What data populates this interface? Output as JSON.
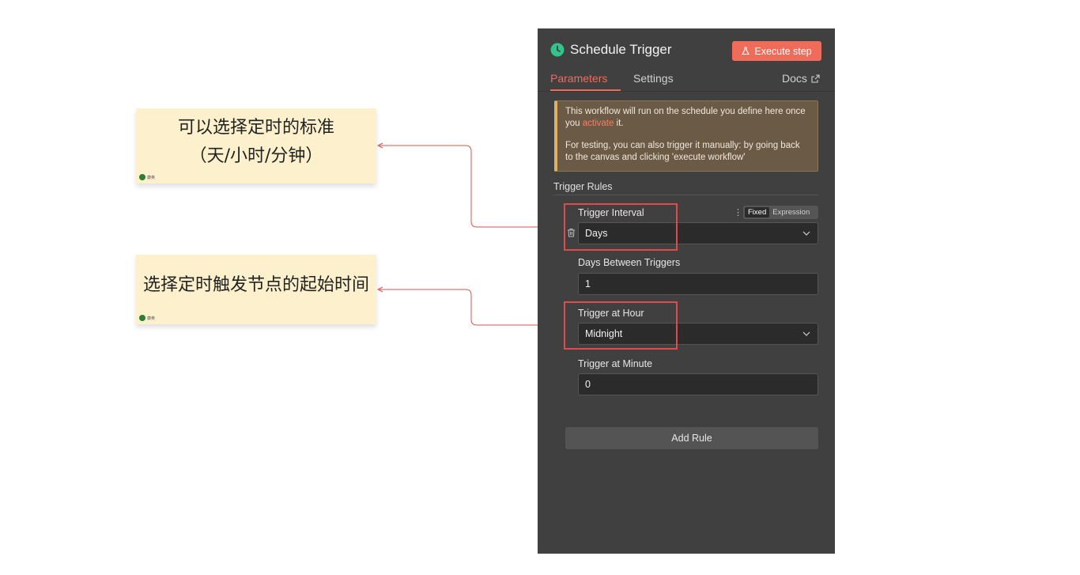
{
  "notes": [
    {
      "text_line1": "可以选择定时的标准",
      "text_line2": "（天/小时/分钟）",
      "tag": "康英"
    },
    {
      "text_line1": "选择定时触发节点的起始时间",
      "tag": "康英"
    }
  ],
  "panel": {
    "title": "Schedule Trigger",
    "execute_label": "Execute step",
    "tabs": {
      "parameters": "Parameters",
      "settings": "Settings",
      "docs": "Docs"
    },
    "notice": {
      "line1_a": "This workflow will run on the schedule you define here",
      "line1_b": "once you",
      "link": "activate",
      "line1_c": "it.",
      "line2": "For testing, you can also trigger it manually: by going back to the canvas and clicking 'execute workflow'"
    },
    "section_title": "Trigger Rules",
    "fixed_label": "Fixed",
    "expression_label": "Expression",
    "fields": {
      "trigger_interval": {
        "label": "Trigger Interval",
        "value": "Days"
      },
      "days_between": {
        "label": "Days Between Triggers",
        "value": "1"
      },
      "trigger_hour": {
        "label": "Trigger at Hour",
        "value": "Midnight"
      },
      "trigger_minute": {
        "label": "Trigger at Minute",
        "value": "0"
      }
    },
    "add_rule_label": "Add Rule"
  },
  "colors": {
    "accent": "#ef6b5a",
    "panel_bg": "#404040",
    "highlight": "#e04a4a",
    "note_bg": "#fdf0cc"
  }
}
